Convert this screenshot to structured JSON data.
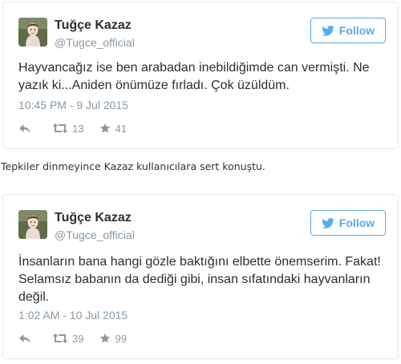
{
  "tweets": [
    {
      "display_name": "Tuğçe Kazaz",
      "screen_name": "@Tugce_official",
      "follow_label": "Follow",
      "text": "Hayvancağız ise ben arabadan inebildiğimde can vermişti. Ne yazık ki...Aniden önümüze fırladı. Çok üzüldüm.",
      "timestamp": "10:45 PM - 9 Jul 2015",
      "retweets": "13",
      "favorites": "41"
    },
    {
      "display_name": "Tuğçe Kazaz",
      "screen_name": "@Tugce_official",
      "follow_label": "Follow",
      "text": "İnsanların bana hangi gözle baktığını elbette önemserim. Fakat! Selamsız babanın da dediği gibi, insan sıfatındaki hayvanların değil.",
      "timestamp": "1:02 AM - 10 Jul 2015",
      "retweets": "39",
      "favorites": "99"
    }
  ],
  "caption": "Tepkiler dinmeyince Kazaz kullanıcılara sert konuştu.",
  "icons": {
    "avatar": "avatar-photo",
    "follow": "twitter-bird-icon",
    "reply": "reply-arrow-icon",
    "retweet": "retweet-icon",
    "favorite": "star-icon"
  },
  "colors": {
    "accent": "#55acee",
    "muted": "#8899a6",
    "text": "#292f33",
    "border": "#e1e8ed"
  }
}
